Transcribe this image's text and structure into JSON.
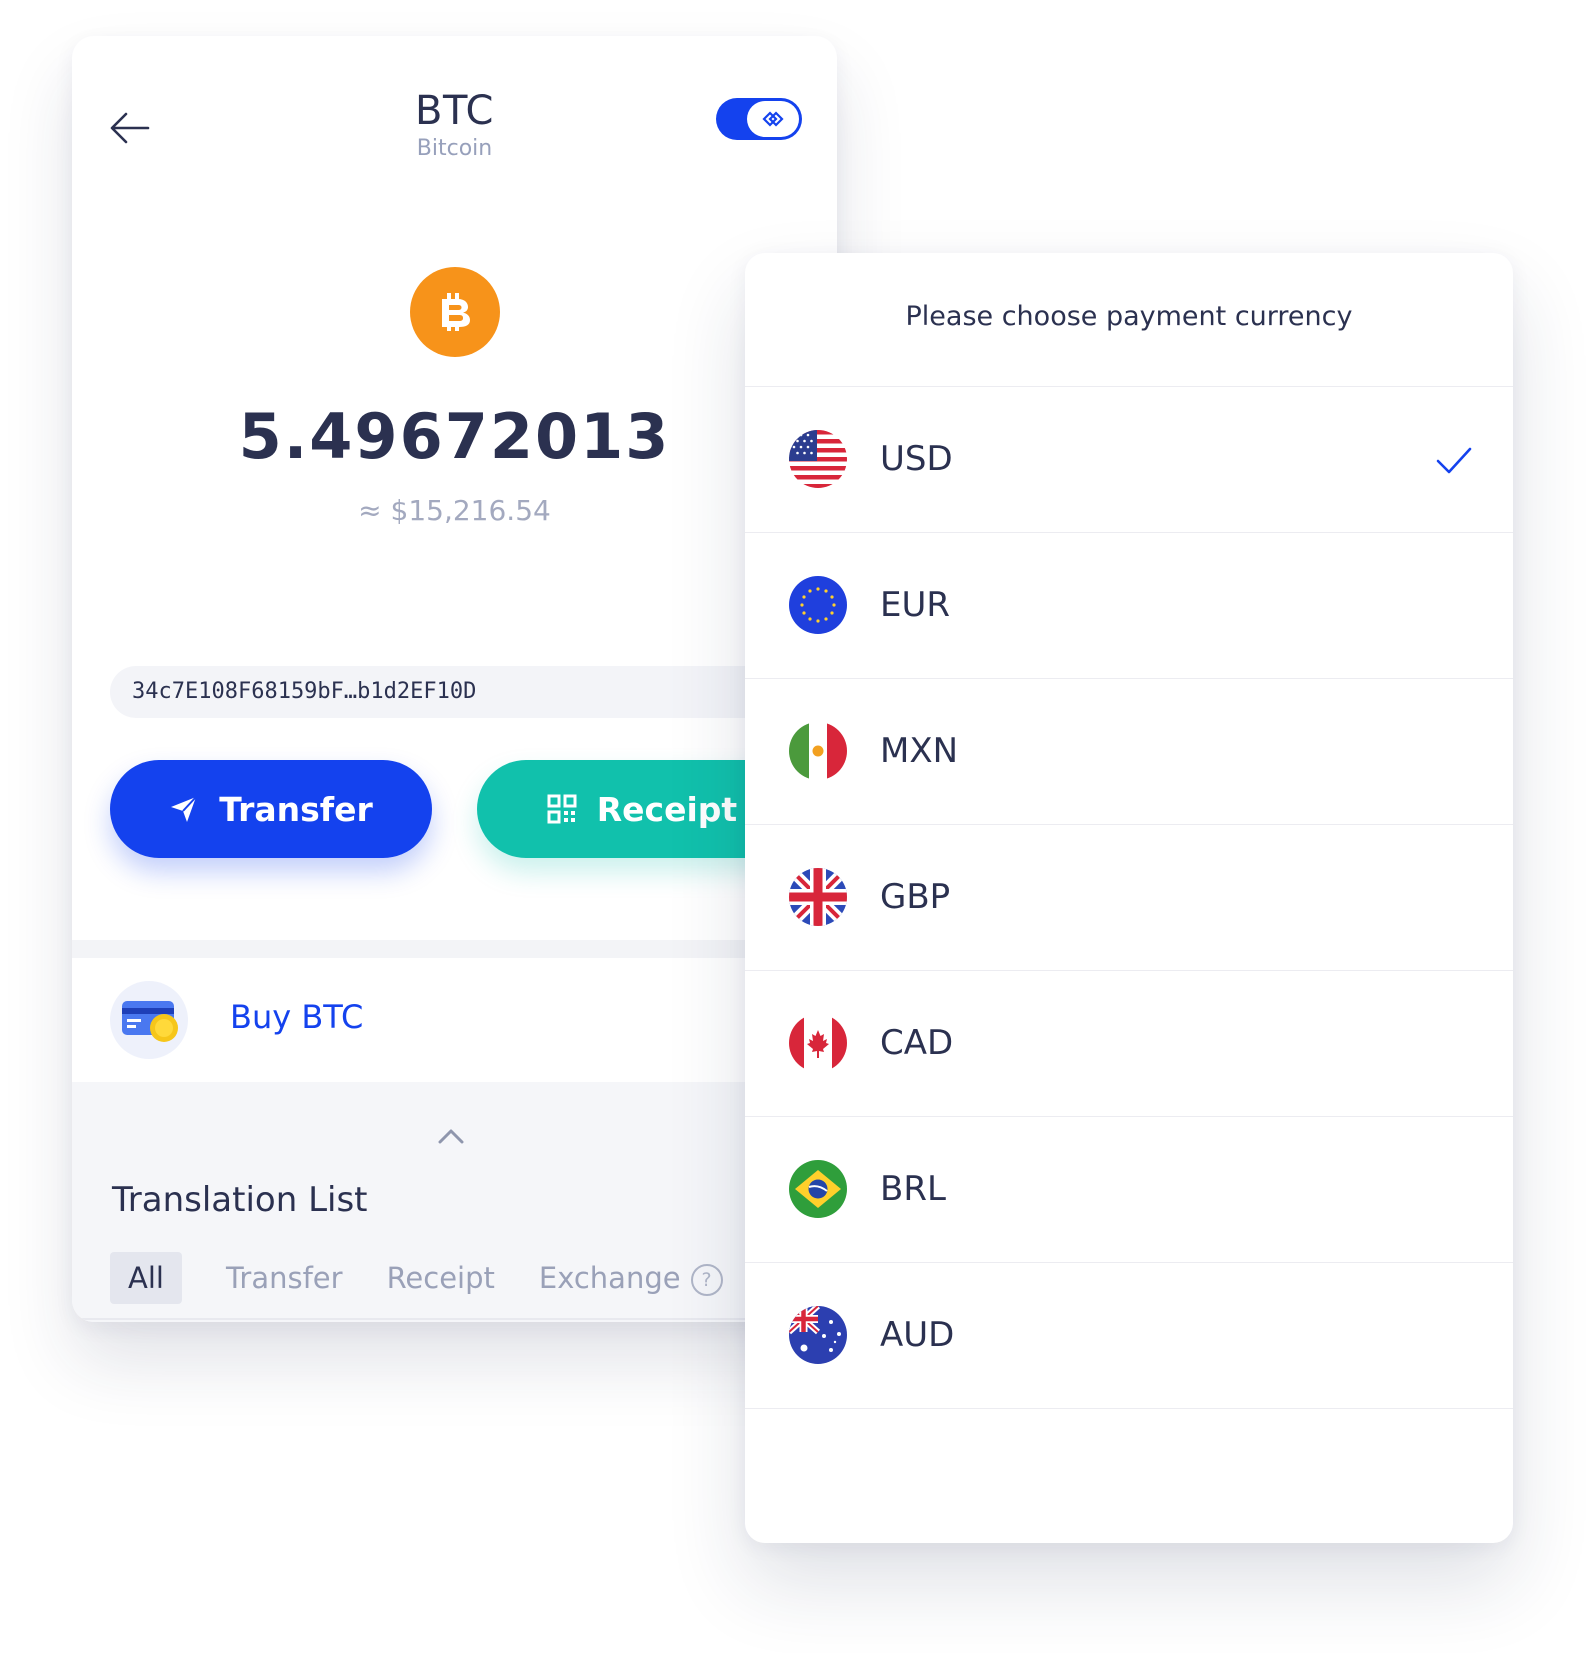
{
  "wallet": {
    "title": "BTC",
    "subtitle": "Bitcoin",
    "balance": "5.49672013",
    "fiat_value": "≈ $15,216.54",
    "address": "34c7E108F68159bF…b1d2EF10D",
    "transfer_label": "Transfer",
    "receipt_label": "Receipt",
    "buy_label": "Buy BTC",
    "tx_title": "Translation List",
    "tabs": [
      {
        "label": "All"
      },
      {
        "label": "Transfer"
      },
      {
        "label": "Receipt"
      },
      {
        "label": "Exchange"
      }
    ],
    "help_glyph": "?",
    "colors": {
      "primary": "#1442ee",
      "teal": "#11c1ac",
      "bitcoin": "#f7931a"
    }
  },
  "currency_sheet": {
    "title": "Please choose payment currency",
    "selected": "USD",
    "currencies": [
      {
        "code": "USD",
        "flag": "us-flag-icon"
      },
      {
        "code": "EUR",
        "flag": "eu-flag-icon"
      },
      {
        "code": "MXN",
        "flag": "mx-flag-icon"
      },
      {
        "code": "GBP",
        "flag": "gb-flag-icon"
      },
      {
        "code": "CAD",
        "flag": "ca-flag-icon"
      },
      {
        "code": "BRL",
        "flag": "br-flag-icon"
      },
      {
        "code": "AUD",
        "flag": "au-flag-icon"
      }
    ]
  }
}
